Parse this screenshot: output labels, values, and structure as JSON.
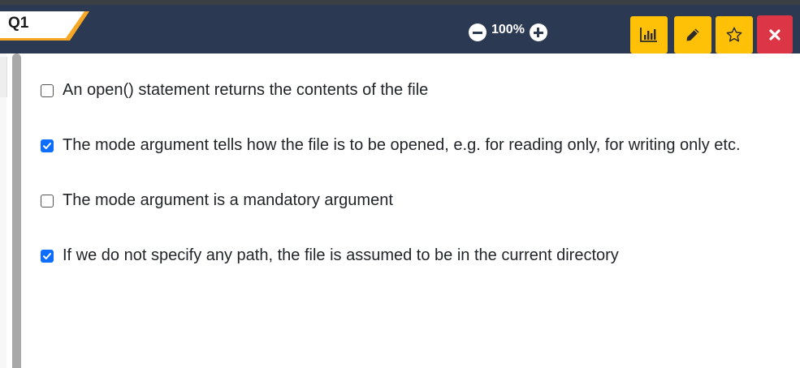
{
  "header": {
    "question_label": "Q1",
    "zoom": {
      "value": "100%"
    },
    "toolbar": {
      "stats_icon": "bar-chart-icon",
      "edit_icon": "pencil-icon",
      "favorite_icon": "star-outline-icon",
      "close_icon": "close-icon"
    }
  },
  "colors": {
    "header_bg": "#2b3a52",
    "tab_accent": "#f5a623",
    "button_yellow": "#ffc107",
    "button_red": "#dc3545",
    "checkbox_checked": "#0d6efd"
  },
  "options": [
    {
      "text": "An open() statement returns the contents of the file",
      "checked": false
    },
    {
      "text": "The mode argument tells how the file is to be opened, e.g. for reading only, for writing only etc.",
      "checked": true
    },
    {
      "text": "The mode argument is a mandatory argument",
      "checked": false
    },
    {
      "text": "If we do not specify any path, the file is assumed to be in the current directory",
      "checked": true
    }
  ]
}
